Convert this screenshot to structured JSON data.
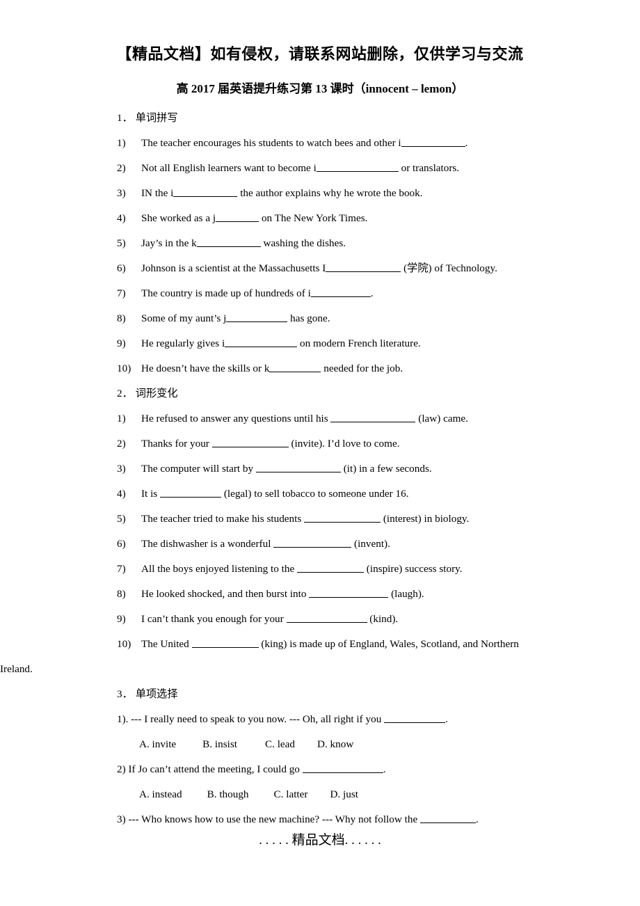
{
  "header": {
    "notice": "【精品文档】如有侵权，请联系网站删除，仅供学习与交流"
  },
  "title": "高 2017 届英语提升练习第 13 课时（innocent – lemon）",
  "sections": [
    {
      "number": "1．",
      "label": "单词拼写",
      "items": [
        {
          "num": "1)",
          "pre": "The teacher encourages his students to watch bees and other i",
          "blank": 92,
          "post": "."
        },
        {
          "num": "2)",
          "pre": "Not all English learners want to become i",
          "blank": 118,
          "post": " or translators."
        },
        {
          "num": "3)",
          "pre": "IN the i",
          "blank": 92,
          "post": " the author explains why he wrote    the book."
        },
        {
          "num": "4)",
          "pre": "She worked as a j",
          "blank": 62,
          "post": " on The New York Times."
        },
        {
          "num": "5)",
          "pre": "Jay’s in the k",
          "blank": 92,
          "post": " washing the dishes."
        },
        {
          "num": "6)",
          "pre": "Johnson is a scientist at the Massachusetts I",
          "blank": 108,
          "post": " (学院) of Technology."
        },
        {
          "num": "7)",
          "pre": "The country is made up of hundreds of i",
          "blank": 86,
          "post": "."
        },
        {
          "num": "8)",
          "pre": "Some of my aunt’s j",
          "blank": 88,
          "post": " has gone."
        },
        {
          "num": "9)",
          "pre": "He regularly gives i",
          "blank": 104,
          "post": " on modern French literature."
        },
        {
          "num": "10)",
          "pre": "He doesn’t have the skills or k",
          "blank": 74,
          "post": " needed for the job."
        }
      ]
    },
    {
      "number": "2．",
      "label": "词形变化",
      "items": [
        {
          "num": "1)",
          "pre": "He refused to answer any questions until his ",
          "blank": 122,
          "post": " (law) came."
        },
        {
          "num": "2)",
          "pre": "Thanks for your ",
          "blank": 110,
          "post": " (invite). I’d love to come."
        },
        {
          "num": "3)",
          "pre": "The computer will start by ",
          "blank": 122,
          "post": " (it) in a few seconds."
        },
        {
          "num": "4)",
          "pre": "It is ",
          "blank": 88,
          "post": " (legal) to sell tobacco to someone under 16."
        },
        {
          "num": "5)",
          "pre": "The teacher tried to make his students ",
          "blank": 110,
          "post": " (interest) in biology."
        },
        {
          "num": "6)",
          "pre": "The dishwasher is a wonderful ",
          "blank": 112,
          "post": " (invent)."
        },
        {
          "num": "7)",
          "pre": "All the boys enjoyed listening to the ",
          "blank": 96,
          "post": " (inspire) success story."
        },
        {
          "num": "8)",
          "pre": "He looked shocked, and then burst into ",
          "blank": 114,
          "post": " (laugh)."
        },
        {
          "num": "9)",
          "pre": "I can’t thank you enough for your ",
          "blank": 116,
          "post": " (kind)."
        },
        {
          "num": "10)",
          "pre": "The United ",
          "blank": 96,
          "post": " (king) is made up of England, Wales, Scotland, and Northern",
          "wrap": "Ireland."
        }
      ]
    },
    {
      "number": "3．",
      "label": "单项选择",
      "items": [
        {
          "num": "1).",
          "pre": " --- I really need to speak to you now.     --- Oh, all right if you ",
          "blank": 88,
          "post": ".",
          "choices": [
            "A. invite",
            "B. insist",
            "C. lead",
            "D. know"
          ],
          "choice_gaps": [
            38,
            40,
            32
          ]
        },
        {
          "num": "2)",
          "pre": " If Jo can’t attend the meeting, I could go ",
          "blank": 116,
          "post": ".",
          "choices": [
            "A. instead",
            "B. though",
            "C. latter",
            "D. just"
          ],
          "choice_gaps": [
            36,
            36,
            32
          ]
        },
        {
          "num": "3)",
          "pre": " --- Who knows how to use the new machine?    --- Why not follow the ",
          "blank": 80,
          "post": ".",
          "choices": [],
          "choice_gaps": []
        }
      ]
    }
  ],
  "footer": ". . . . . 精品文档. . . . . ."
}
